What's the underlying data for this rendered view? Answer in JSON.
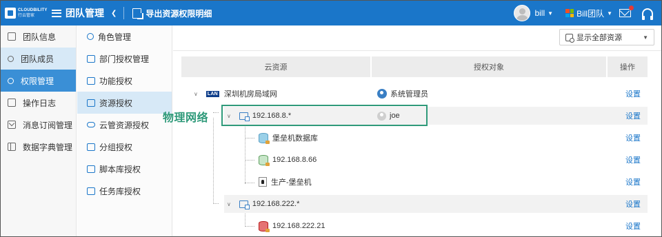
{
  "header": {
    "logo_en": "CLOUDBILITY",
    "logo_cn": "行云管家",
    "title": "团队管理",
    "export_label": "导出资源权限明细",
    "user_name": "bill",
    "team_name": "Bill团队",
    "brand_color": "#1a76c9"
  },
  "sidebar": {
    "items": [
      {
        "label": "团队信息",
        "icon": "doc-icon"
      },
      {
        "label": "团队成员",
        "icon": "users-icon"
      },
      {
        "label": "权限管理",
        "icon": "permission-icon"
      },
      {
        "label": "操作日志",
        "icon": "log-icon"
      },
      {
        "label": "消息订阅管理",
        "icon": "envelope-icon"
      },
      {
        "label": "数据字典管理",
        "icon": "book-icon"
      }
    ]
  },
  "subnav": {
    "items": [
      {
        "label": "角色管理"
      },
      {
        "label": "部门授权管理"
      },
      {
        "label": "功能授权"
      },
      {
        "label": "资源授权"
      },
      {
        "label": "云管资源授权"
      },
      {
        "label": "分组授权"
      },
      {
        "label": "脚本库授权"
      },
      {
        "label": "任务库授权"
      }
    ]
  },
  "filter": {
    "label": "显示全部资源"
  },
  "table": {
    "headers": [
      "云资源",
      "授权对象",
      "操作"
    ],
    "action_label": "设置",
    "rows": [
      {
        "name": "深圳机房局域网",
        "badge": "LAN",
        "object": "系统管理员"
      },
      {
        "name": "192.168.8.*",
        "object": "joe"
      },
      {
        "name": "堡垒机数据库",
        "object": ""
      },
      {
        "name": "192.168.8.66",
        "object": ""
      },
      {
        "name": "生产-堡垒机",
        "object": ""
      },
      {
        "name": "192.168.222.*",
        "object": ""
      },
      {
        "name": "192.168.222.21",
        "object": ""
      }
    ]
  },
  "annotation": {
    "text": "物理网络",
    "color": "#2f9a7a"
  }
}
